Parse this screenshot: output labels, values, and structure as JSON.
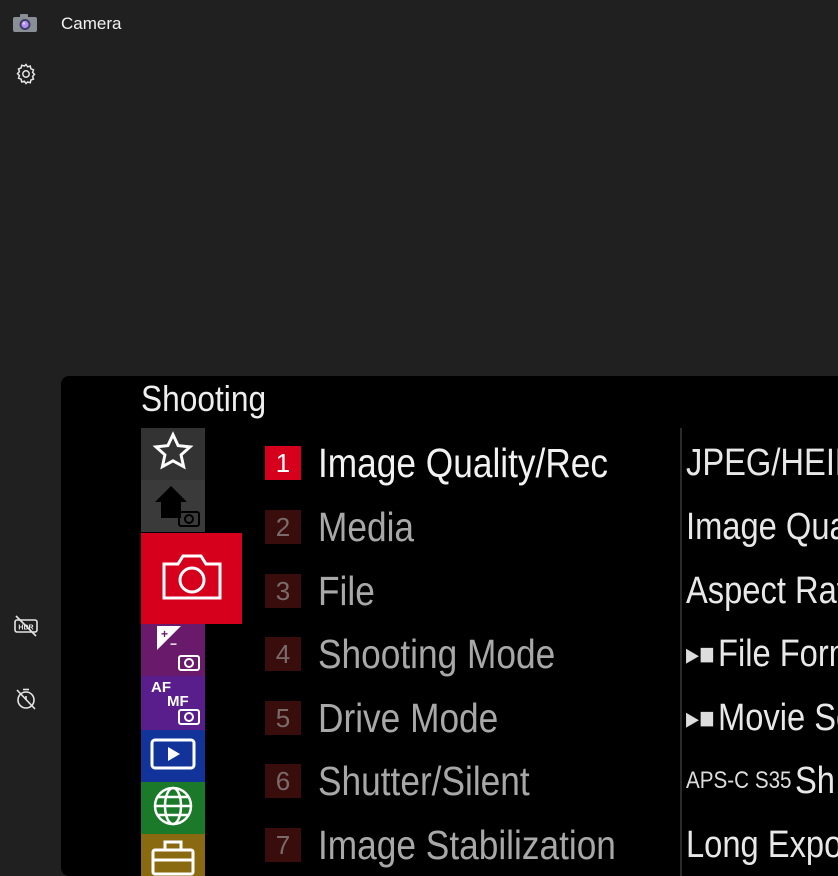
{
  "app": {
    "title": "Camera"
  },
  "sidebar": {
    "settings_icon": "gear-icon",
    "hdr_icon": "hdr-off-icon",
    "timer_icon": "timer-off-icon"
  },
  "viewfinder": {
    "menu_title": "Shooting",
    "tabs": [
      "star-icon",
      "home-camera-icon",
      "camera-icon",
      "exposure-camera-icon",
      "af-mf-camera-icon",
      "playback-icon",
      "globe-icon",
      "toolbox-icon"
    ],
    "items": [
      {
        "num": "1",
        "label": "Image Quality/Rec",
        "selected": true
      },
      {
        "num": "2",
        "label": "Media",
        "selected": false
      },
      {
        "num": "3",
        "label": "File",
        "selected": false
      },
      {
        "num": "4",
        "label": "Shooting Mode",
        "selected": false
      },
      {
        "num": "5",
        "label": "Drive Mode",
        "selected": false
      },
      {
        "num": "6",
        "label": "Shutter/Silent",
        "selected": false
      },
      {
        "num": "7",
        "label": "Image Stabilization",
        "selected": false
      }
    ],
    "subitems": [
      {
        "prefix": "",
        "label": "JPEG/HEIF"
      },
      {
        "prefix": "",
        "label": "Image Qual"
      },
      {
        "prefix": "",
        "label": "Aspect Rati"
      },
      {
        "prefix": "▸■",
        "label": "File Form"
      },
      {
        "prefix": "▸■",
        "label": "Movie Se"
      },
      {
        "prefix": "APS-C S35",
        "label": "Sh"
      },
      {
        "prefix": "",
        "label": "Long Expos"
      }
    ]
  },
  "colors": {
    "accent": "#d6001c",
    "background": "#202020"
  }
}
